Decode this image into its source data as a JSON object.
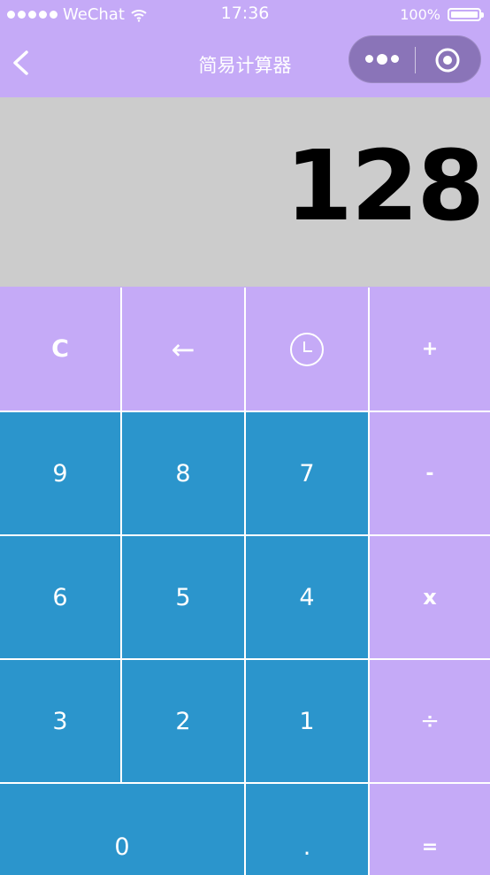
{
  "status_bar": {
    "carrier": "WeChat",
    "time": "17:36",
    "battery_text": "100%"
  },
  "nav": {
    "title": "简易计算器"
  },
  "display": {
    "value": "128"
  },
  "keys": {
    "clear": "C",
    "backspace": "←",
    "plus": "+",
    "nine": "9",
    "eight": "8",
    "seven": "7",
    "minus": "-",
    "six": "6",
    "five": "5",
    "four": "4",
    "multiply": "x",
    "three": "3",
    "two": "2",
    "one": "1",
    "divide": "÷",
    "zero": "0",
    "dot": ".",
    "equals": "="
  },
  "colors": {
    "accent_purple": "#c5aaf7",
    "digit_blue": "#2b95cc",
    "display_gray": "#cccccc"
  },
  "icons": {
    "history": "clock-icon",
    "back": "chevron-left-icon",
    "menu": "more-dots-icon",
    "close": "target-circle-icon"
  }
}
